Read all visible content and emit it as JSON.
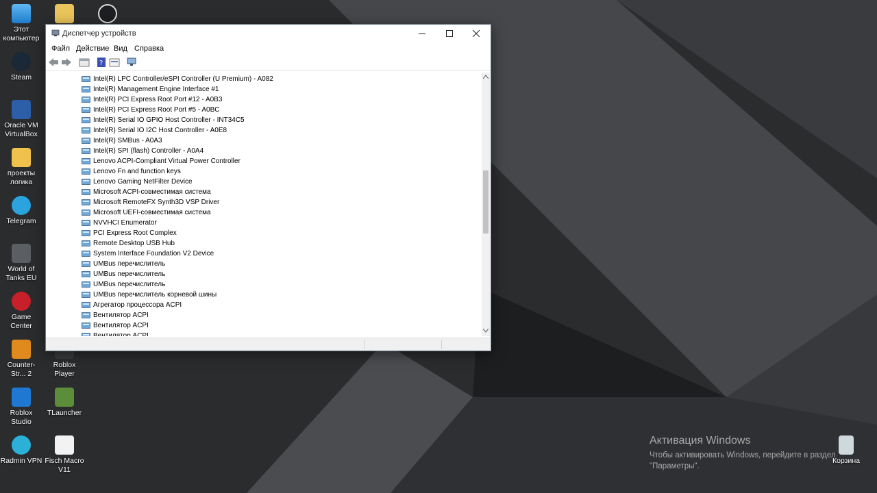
{
  "desktop": {
    "icons": [
      {
        "label": "Этот компьютер"
      },
      {
        "label": "Steam"
      },
      {
        "label": "Oracle VM VirtualBox"
      },
      {
        "label": "проекты логика"
      },
      {
        "label": "Telegram"
      },
      {
        "label": "World of Tanks EU"
      },
      {
        "label": "Game Center"
      },
      {
        "label": "Counter-Str... 2"
      },
      {
        "label": "Roblox Player"
      },
      {
        "label": "Roblox Studio"
      },
      {
        "label": "TLauncher"
      },
      {
        "label": "Radmin VPN"
      },
      {
        "label": "Fisch Macro V11"
      },
      {
        "label": "Корзина"
      }
    ],
    "activation": {
      "title": "Активация Windows",
      "line1": "Чтобы активировать Windows, перейдите в раздел",
      "line2": "\"Параметры\"."
    }
  },
  "window": {
    "title": "Диспетчер устройств",
    "menu": [
      "Файл",
      "Действие",
      "Вид",
      "Справка"
    ],
    "devices": [
      "Intel(R) LPC Controller/eSPI Controller (U Premium) - A082",
      "Intel(R) Management Engine Interface #1",
      "Intel(R) PCI Express Root Port #12 - A0B3",
      "Intel(R) PCI Express Root Port #5 - A0BC",
      "Intel(R) Serial IO GPIO Host Controller - INT34C5",
      "Intel(R) Serial IO I2C Host Controller - A0E8",
      "Intel(R) SMBus - A0A3",
      "Intel(R) SPI (flash) Controller - A0A4",
      "Lenovo ACPI-Compliant Virtual Power Controller",
      "Lenovo Fn and function keys",
      "Lenovo Gaming NetFilter Device",
      "Microsoft ACPI-совместимая система",
      "Microsoft RemoteFX Synth3D VSP Driver",
      "Microsoft UEFI-совместимая система",
      "NVVHCI Enumerator",
      "PCI Express Root Complex",
      "Remote Desktop USB Hub",
      "System Interface Foundation V2 Device",
      "UMBus перечислитель",
      "UMBus перечислитель",
      "UMBus перечислитель",
      "UMBus перечислитель корневой шины",
      "Агрегатор процессора ACPI",
      "Вентилятор ACPI",
      "Вентилятор ACPI",
      "Вентилятор ACPI"
    ]
  }
}
